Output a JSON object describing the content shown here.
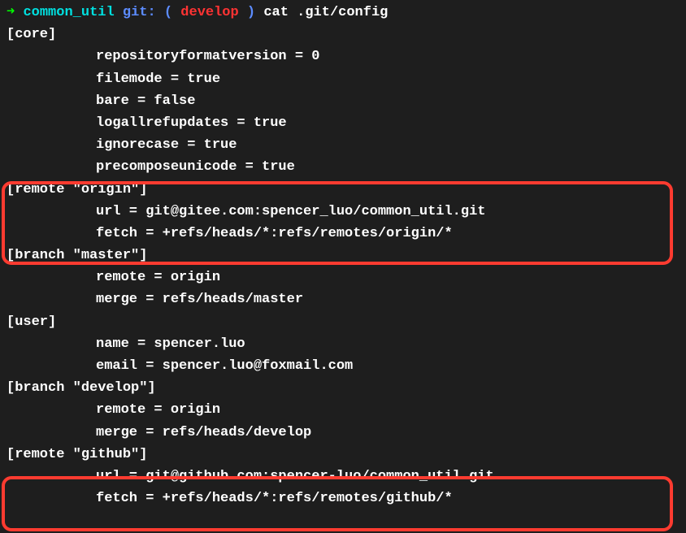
{
  "prompt": {
    "arrow": "➜",
    "repo": "common_util",
    "git_label": "git:",
    "paren_open": "(",
    "branch": "develop",
    "paren_close": ")",
    "command": "cat .git/config"
  },
  "lines": {
    "core_header": "[core]",
    "core_repoversion": "repositoryformatversion = 0",
    "core_filemode": "filemode = true",
    "core_bare": "bare = false",
    "core_logallref": "logallrefupdates = true",
    "core_ignorecase": "ignorecase = true",
    "core_precompose": "precomposeunicode = true",
    "remote_origin_header": "[remote \"origin\"]",
    "remote_origin_url": "url = git@gitee.com:spencer_luo/common_util.git",
    "remote_origin_fetch": "fetch = +refs/heads/*:refs/remotes/origin/*",
    "branch_master_header": "[branch \"master\"]",
    "branch_master_remote": "remote = origin",
    "branch_master_merge": "merge = refs/heads/master",
    "user_header": "[user]",
    "user_name": "name = spencer.luo",
    "user_email": "email = spencer.luo@foxmail.com",
    "branch_develop_header": "[branch \"develop\"]",
    "branch_develop_remote": "remote = origin",
    "branch_develop_merge": "merge = refs/heads/develop",
    "remote_github_header": "[remote \"github\"]",
    "remote_github_url": "url = git@github.com:spencer-luo/common_util.git",
    "remote_github_fetch": "fetch = +refs/heads/*:refs/remotes/github/*"
  }
}
